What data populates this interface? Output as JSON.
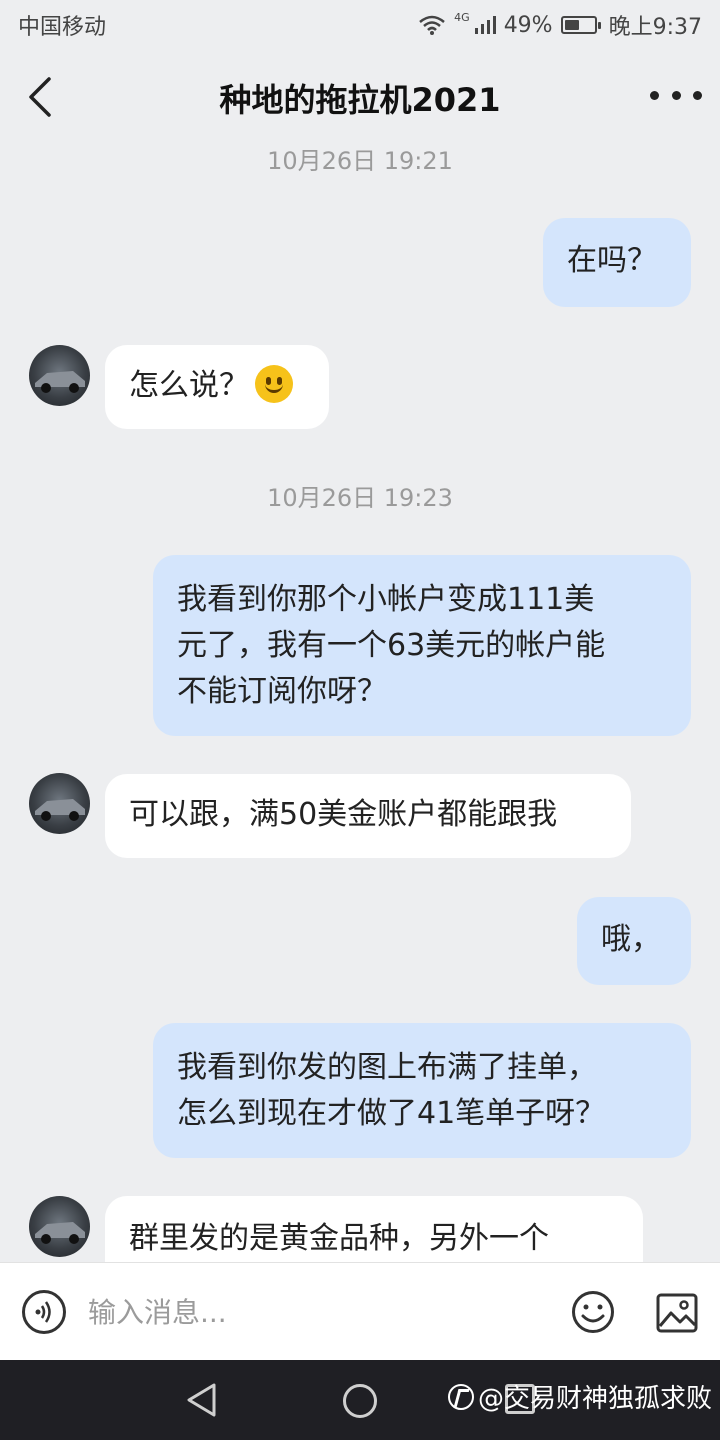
{
  "status_bar": {
    "carrier": "中国移动",
    "network": "4G",
    "battery": "49%",
    "battery_level": 0.49,
    "time": "晚上9:37"
  },
  "header": {
    "title": "种地的拖拉机2021"
  },
  "chat": {
    "timestamps": [
      "10月26日 19:21",
      "10月26日 19:23"
    ],
    "messages": [
      {
        "from": "me",
        "line1": "在吗？"
      },
      {
        "from": "other",
        "line1": "怎么说？",
        "emoji": "smile-emoji"
      },
      {
        "from": "me",
        "line1": "我看到你那个小帐户变成111美",
        "line2": "元了，我有一个63美元的帐户能",
        "line3": "不能订阅你呀？"
      },
      {
        "from": "other",
        "line1": "可以跟，满50美金账户都能跟我"
      },
      {
        "from": "me",
        "line1": "哦，"
      },
      {
        "from": "me",
        "line1": "我看到你发的图上布满了挂单，",
        "line2": "怎么到现在才做了41笔单子呀？"
      },
      {
        "from": "other",
        "line1": "群里发的是黄金品种，另外一个"
      }
    ]
  },
  "input_bar": {
    "placeholder": "输入消息..."
  },
  "watermark": {
    "text": "@交易财神独孤求败"
  },
  "colors": {
    "outgoing_bubble": "#d4e5fc",
    "incoming_bubble": "#ffffff",
    "background": "#edeef0"
  }
}
